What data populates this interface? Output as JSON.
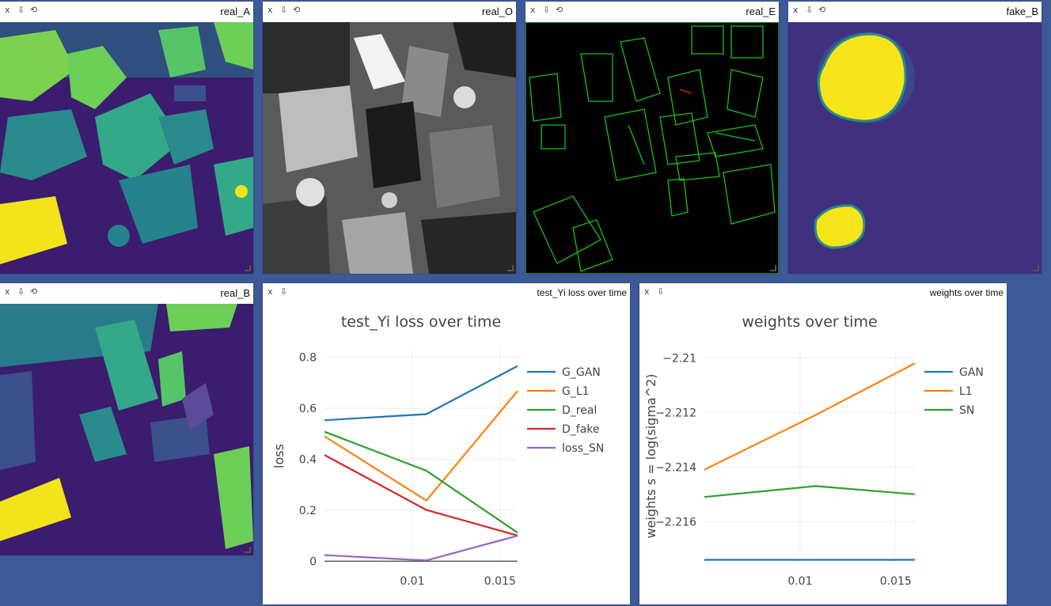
{
  "panes": [
    {
      "id": "real_A",
      "title": "real_A"
    },
    {
      "id": "real_O",
      "title": "real_O"
    },
    {
      "id": "real_E",
      "title": "real_E"
    },
    {
      "id": "fake_B",
      "title": "fake_B"
    },
    {
      "id": "real_B",
      "title": "real_B"
    }
  ],
  "toolbar": {
    "close": "x",
    "download": "⇩",
    "reset": "⟲"
  },
  "colors": {
    "background": "#3d5a98",
    "viridis_dark": "#3b1c6e",
    "viridis_mid": "#2b8a8c",
    "viridis_teal": "#33a98a",
    "viridis_green": "#6cce58",
    "viridis_yellow": "#f3e31b",
    "edge_green": "#19c119"
  },
  "chart_loss": {
    "pane_title": "test_Yi loss over time",
    "chart_data": {
      "type": "line",
      "title": "test_Yi loss over time",
      "xlabel": "",
      "ylabel": "loss",
      "x": [
        0.005,
        0.0108,
        0.016
      ],
      "xticks": [
        0.01,
        0.015
      ],
      "xtick_labels": [
        "0.01",
        "0.015"
      ],
      "yticks": [
        0,
        0.2,
        0.4,
        0.6,
        0.8
      ],
      "ytick_labels": [
        "0",
        "0.2",
        "0.4",
        "0.6",
        "0.8"
      ],
      "xlim": [
        0.005,
        0.016
      ],
      "ylim": [
        -0.005,
        0.83
      ],
      "grid": true,
      "legend": "right",
      "series": [
        {
          "name": "G_GAN",
          "color": "#1f77b4",
          "values": [
            0.553,
            0.577,
            0.766
          ]
        },
        {
          "name": "G_L1",
          "color": "#ff7f0e",
          "values": [
            0.49,
            0.238,
            0.668
          ]
        },
        {
          "name": "D_real",
          "color": "#2ca02c",
          "values": [
            0.508,
            0.355,
            0.112
          ]
        },
        {
          "name": "D_fake",
          "color": "#d62728",
          "values": [
            0.417,
            0.201,
            0.101
          ]
        },
        {
          "name": "loss_SN",
          "color": "#9467bd",
          "values": [
            0.024,
            0.003,
            0.1
          ]
        }
      ]
    }
  },
  "chart_weights": {
    "pane_title": "weights over time",
    "chart_data": {
      "type": "line",
      "title": "weights over time",
      "xlabel": "",
      "ylabel": "weights s = log(sigma^2)",
      "x": [
        0.005,
        0.0108,
        0.016
      ],
      "xticks": [
        0.01,
        0.015
      ],
      "xtick_labels": [
        "0.01",
        "0.015"
      ],
      "yticks": [
        -2.21,
        -2.212,
        -2.214,
        -2.216
      ],
      "ytick_labels": [
        "−2.21",
        "−2.212",
        "−2.214",
        "−2.216"
      ],
      "xlim": [
        0.005,
        0.016
      ],
      "ylim": [
        -2.2175,
        -2.2097
      ],
      "grid": true,
      "legend": "right",
      "series": [
        {
          "name": "GAN",
          "color": "#1f77b4",
          "values": [
            -2.2174,
            -2.2174,
            -2.2174
          ]
        },
        {
          "name": "L1",
          "color": "#ff7f0e",
          "values": [
            -2.2141,
            -2.2121,
            -2.2102
          ]
        },
        {
          "name": "SN",
          "color": "#2ca02c",
          "values": [
            -2.2151,
            -2.2147,
            -2.215
          ]
        }
      ]
    }
  }
}
